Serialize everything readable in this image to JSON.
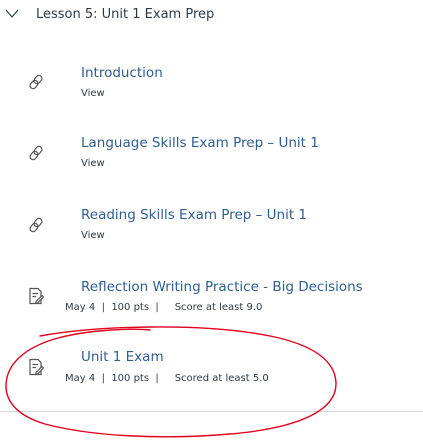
{
  "module": {
    "title": "Lesson 5: Unit 1 Exam Prep",
    "toggle_icon": "chevron-down-icon"
  },
  "items": [
    {
      "title": "Introduction",
      "icon": "link-icon",
      "sub": "View"
    },
    {
      "title": "Language Skills Exam Prep – Unit 1",
      "icon": "link-icon",
      "sub": "View"
    },
    {
      "title": "Reading Skills Exam Prep – Unit 1",
      "icon": "link-icon",
      "sub": "View"
    },
    {
      "title": "Reflection Writing Practice - Big Decisions",
      "icon": "assignment-icon",
      "date": "May 4",
      "sep1": "|",
      "points": "100 pts",
      "sep2": "|",
      "requirement": "Score at least 9.0"
    },
    {
      "title": "Unit 1 Exam",
      "icon": "assignment-icon",
      "date": "May 4",
      "sep1": "|",
      "points": "100 pts",
      "sep2": "|",
      "requirement": "Scored at least 5.0"
    }
  ],
  "colors": {
    "link": "#2f5e93",
    "text": "#2d3b45",
    "annotation": "#e0001b"
  }
}
